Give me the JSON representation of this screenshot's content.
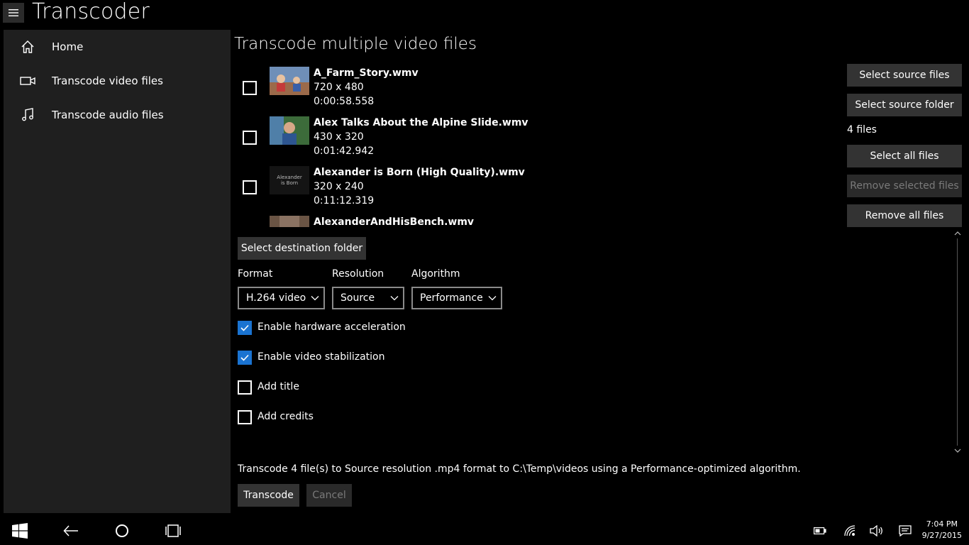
{
  "app": {
    "title": "Transcoder"
  },
  "nav": {
    "items": [
      {
        "label": "Home",
        "icon": "home-icon"
      },
      {
        "label": "Transcode video files",
        "icon": "video-camera-icon"
      },
      {
        "label": "Transcode audio files",
        "icon": "music-note-icon"
      }
    ]
  },
  "main": {
    "title": "Transcode multiple video files",
    "files": [
      {
        "name": "A_Farm_Story.wmv",
        "resolution": "720 x 480",
        "duration": "0:00:58.558",
        "checked": false
      },
      {
        "name": "Alex Talks About the Alpine Slide.wmv",
        "resolution": "430 x 320",
        "duration": "0:01:42.942",
        "checked": false
      },
      {
        "name": "Alexander is Born (High Quality).wmv",
        "resolution": "320 x 240",
        "duration": "0:11:12.319",
        "checked": false,
        "thumb_text": "Alexander is Born"
      },
      {
        "name": "AlexanderAndHisBench.wmv",
        "resolution": "",
        "duration": "",
        "checked": false
      }
    ],
    "select_destination_label": "Select destination folder",
    "format": {
      "label": "Format",
      "value": "H.264 video"
    },
    "resolution": {
      "label": "Resolution",
      "value": "Source"
    },
    "algorithm": {
      "label": "Algorithm",
      "value": "Performance"
    },
    "options": [
      {
        "label": "Enable hardware acceleration",
        "checked": true
      },
      {
        "label": "Enable video stabilization",
        "checked": true
      },
      {
        "label": "Add title",
        "checked": false
      },
      {
        "label": "Add credits",
        "checked": false
      }
    ],
    "summary": "Transcode 4 file(s) to Source resolution .mp4 format to C:\\Temp\\videos using a Performance-optimized algorithm.",
    "transcode_label": "Transcode",
    "cancel_label": "Cancel"
  },
  "side": {
    "select_source_files": "Select source files",
    "select_source_folder": "Select source folder",
    "files_count": "4 files",
    "select_all_files": "Select all files",
    "remove_selected_files": "Remove selected files",
    "remove_all_files": "Remove all files"
  },
  "taskbar": {
    "time": "7:04 PM",
    "date": "9/27/2015"
  },
  "colors": {
    "accent": "#1a73d1",
    "button": "#333333",
    "nav_bg": "#1f1f1f"
  }
}
